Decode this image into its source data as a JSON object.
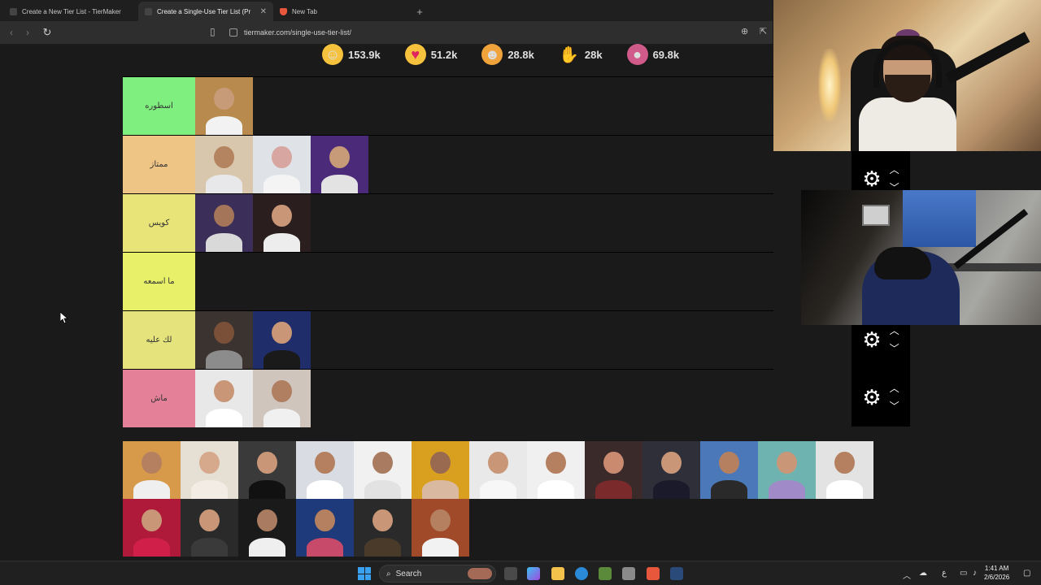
{
  "browser": {
    "tabs": [
      {
        "title": "Create a New Tier List - TierMaker",
        "active": false,
        "icon": "tiermaker-icon"
      },
      {
        "title": "Create a Single-Use Tier List (Pr",
        "active": true,
        "icon": "tiermaker-icon"
      },
      {
        "title": "New Tab",
        "active": false,
        "icon": "brave-icon"
      }
    ],
    "new_tab_label": "+",
    "url": "tiermaker.com/single-use-tier-list/"
  },
  "reactions": [
    {
      "icon": "grin-emoji-icon",
      "count": "153.9k",
      "color": "#f6c23e"
    },
    {
      "icon": "heart-eyes-emoji-icon",
      "count": "51.2k",
      "color": "#f6a3b8"
    },
    {
      "icon": "laughing-emoji-icon",
      "count": "28.8k",
      "color": "#f0a33b"
    },
    {
      "icon": "raised-hands-emoji-icon",
      "count": "28k",
      "color": "#f3c43a"
    },
    {
      "icon": "poop-emoji-icon",
      "count": "69.8k",
      "color": "#d05a8a"
    }
  ],
  "tiers": [
    {
      "label": "اسطوره",
      "color": "#7ff07f",
      "items": 1
    },
    {
      "label": "ممتاز",
      "color": "#efc586",
      "items": 3
    },
    {
      "label": "كويس",
      "color": "#e8e477",
      "items": 2
    },
    {
      "label": "ما اسمعه",
      "color": "#e8f06a",
      "items": 0
    },
    {
      "label": "لك عليه",
      "color": "#e5e37c",
      "items": 2
    },
    {
      "label": "ماش",
      "color": "#e58099",
      "items": 2
    }
  ],
  "taskbar": {
    "search_label": "Search",
    "time": "1:41 AM",
    "date": "2/6/2026",
    "tray_lang": "ع"
  },
  "colors": {
    "page_bg": "#1a1a1a",
    "accent_blue": "#3aa0f0"
  }
}
